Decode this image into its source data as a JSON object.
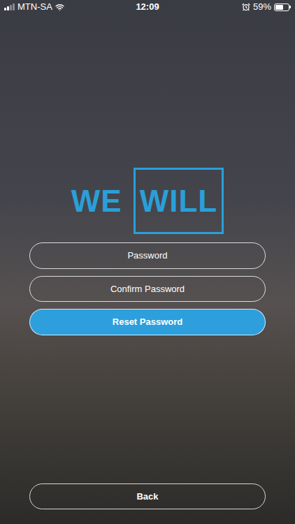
{
  "status_bar": {
    "carrier": "MTN-SA",
    "signal_level": 0.5,
    "time": "12:09",
    "battery": "59%",
    "battery_level": 0.59
  },
  "logo": {
    "left": "WE",
    "right": "WILL"
  },
  "fields": [
    {
      "placeholder": "Password"
    },
    {
      "placeholder": "Confirm Password"
    }
  ],
  "buttons": [
    {
      "label": "Reset Password",
      "primary": true
    },
    {
      "label": "Back",
      "primary": false
    }
  ]
}
